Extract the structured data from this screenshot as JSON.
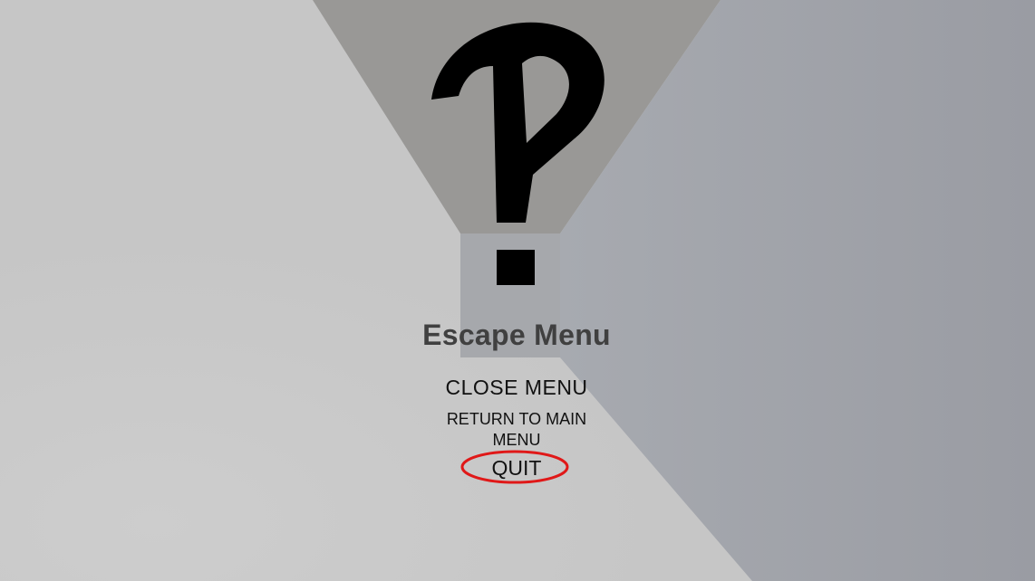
{
  "scene": {
    "colors": {
      "floor": "#c6c6c6",
      "ceiling": "#999896",
      "right_wall": "#9fa2a8",
      "far_wall": "#a6a8ac",
      "question_mark": "#000000",
      "highlight_ring": "#e01818"
    },
    "icon": "question-mark"
  },
  "menu": {
    "title": "Escape Menu",
    "close_label": "CLOSE MENU",
    "return_label": "RETURN TO MAIN MENU",
    "quit_label": "QUIT"
  }
}
